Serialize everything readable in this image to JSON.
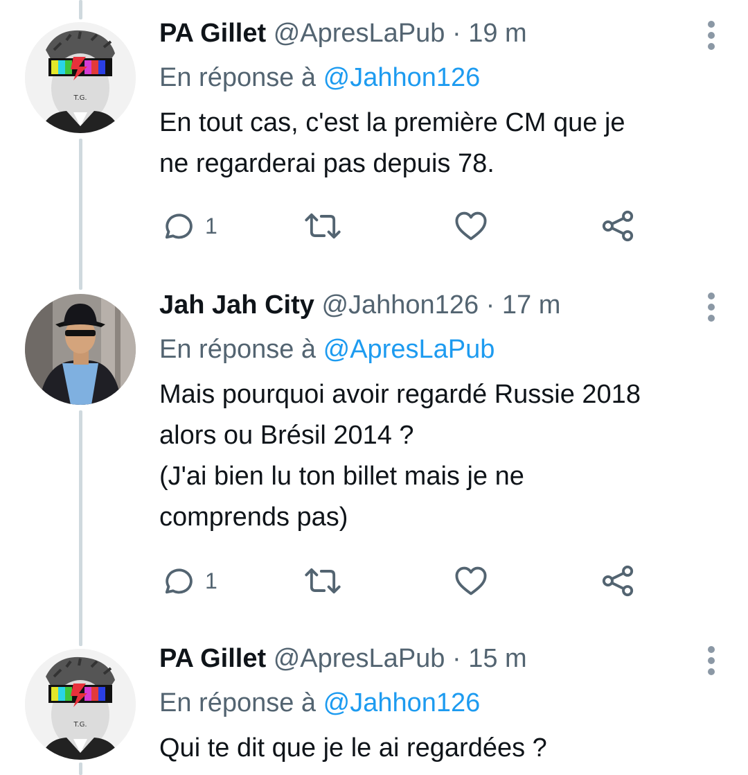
{
  "tweets": [
    {
      "name": "PA Gillet",
      "handle": "@ApresLaPub",
      "separator": "·",
      "time": "19 m",
      "reply_prefix": "En réponse à",
      "reply_to": "@Jahhon126",
      "text_lines": [
        "En tout cas, c'est la première CM que je",
        "ne regarderai pas depuis 78."
      ],
      "reply_count": "1",
      "avatar_text": "T.G."
    },
    {
      "name": "Jah Jah City",
      "handle": "@Jahhon126",
      "separator": "·",
      "time": "17 m",
      "reply_prefix": "En réponse à",
      "reply_to": "@ApresLaPub",
      "text_lines": [
        "Mais pourquoi avoir regardé Russie 2018",
        "alors ou Brésil 2014 ?",
        "(J'ai bien lu ton billet mais je ne",
        "comprends pas)"
      ],
      "reply_count": "1"
    },
    {
      "name": "PA Gillet",
      "handle": "@ApresLaPub",
      "separator": "·",
      "time": "15 m",
      "reply_prefix": "En réponse à",
      "reply_to": "@Jahhon126",
      "text_lines": [
        "Qui te dit que je le ai regardées ?"
      ],
      "avatar_text": "T.G."
    }
  ],
  "icons": {
    "reply": "reply-icon",
    "retweet": "retweet-icon",
    "like": "like-icon",
    "share": "share-icon",
    "more": "more-vertical-icon"
  },
  "colors": {
    "mention": "#1d9bf0",
    "secondary_text": "#536471",
    "thread_line": "#cfd9de"
  }
}
